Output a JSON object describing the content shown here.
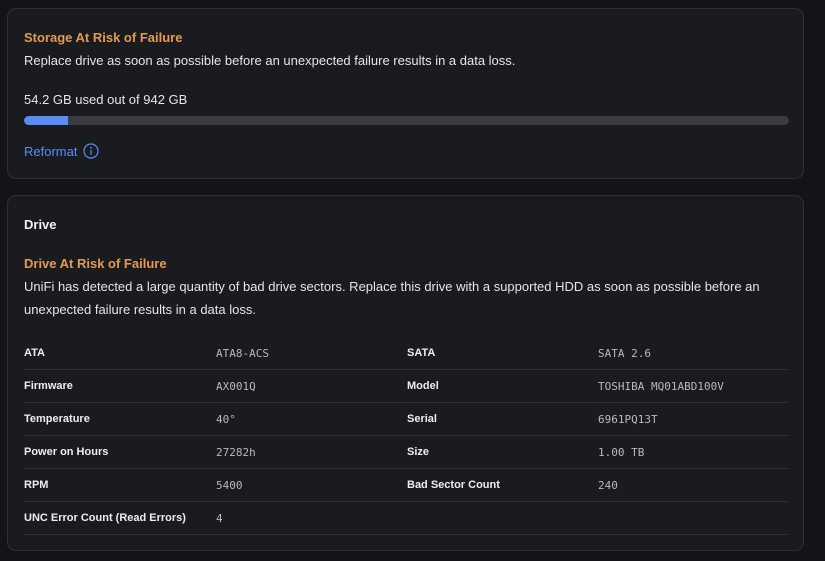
{
  "storage": {
    "warning_title": "Storage At Risk of Failure",
    "warning_description": "Replace drive as soon as possible before an unexpected failure results in a data loss.",
    "usage_text": "54.2 GB used out of 942 GB",
    "used_gb": 54.2,
    "total_gb": 942,
    "used_fraction": 0.0575,
    "bar_color": "#5b8cf5",
    "reformat_label": "Reformat",
    "reformat_icon": "info-circle-icon"
  },
  "drive": {
    "heading": "Drive",
    "warning_title": "Drive At Risk of Failure",
    "warning_description": "UniFi has detected a large quantity of bad drive sectors. Replace this drive with a supported HDD as soon as possible before an unexpected failure results in a data loss.",
    "specs": [
      {
        "label1": "ATA",
        "value1": "ATA8-ACS",
        "label2": "SATA",
        "value2": "SATA 2.6"
      },
      {
        "label1": "Firmware",
        "value1": "AX001Q",
        "label2": "Model",
        "value2": "TOSHIBA MQ01ABD100V"
      },
      {
        "label1": "Temperature",
        "value1": "40°",
        "label2": "Serial",
        "value2": "6961PQ13T"
      },
      {
        "label1": "Power on Hours",
        "value1": "27282h",
        "label2": "Size",
        "value2": "1.00 TB"
      },
      {
        "label1": "RPM",
        "value1": "5400",
        "label2": "Bad Sector Count",
        "value2": "240"
      },
      {
        "label1": "UNC Error Count (Read Errors)",
        "value1": "4",
        "label2": "",
        "value2": ""
      }
    ]
  },
  "colors": {
    "warning": "#e49a52",
    "accent": "#5b8cf5",
    "background": "#131417",
    "card": "#1a1b1f"
  }
}
